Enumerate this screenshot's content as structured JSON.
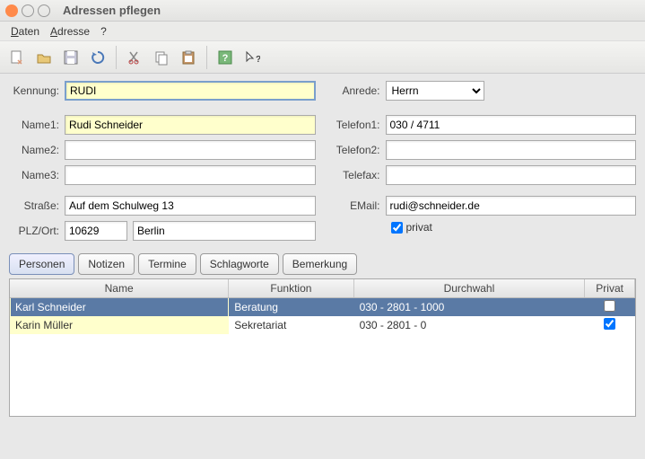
{
  "window": {
    "title": "Adressen pflegen"
  },
  "menu": {
    "daten": "Daten",
    "adresse": "Adresse",
    "help": "?"
  },
  "toolbar_icons": [
    "new",
    "open",
    "save",
    "refresh",
    "cut",
    "copy",
    "paste",
    "help",
    "pointer"
  ],
  "form": {
    "labels": {
      "kennung": "Kennung:",
      "name1": "Name1:",
      "name2": "Name2:",
      "name3": "Name3:",
      "strasse": "Straße:",
      "plzort": "PLZ/Ort:",
      "anrede": "Anrede:",
      "telefon1": "Telefon1:",
      "telefon2": "Telefon2:",
      "telefax": "Telefax:",
      "email": "EMail:",
      "privat": "privat"
    },
    "values": {
      "kennung": "RUDI",
      "name1": "Rudi Schneider",
      "name2": "",
      "name3": "",
      "strasse": "Auf dem Schulweg 13",
      "plz": "10629",
      "ort": "Berlin",
      "anrede": "Herrn",
      "telefon1": "030 / 4711",
      "telefon2": "",
      "telefax": "",
      "email": "rudi@schneider.de",
      "privat": true
    }
  },
  "tabs": {
    "personen": "Personen",
    "notizen": "Notizen",
    "termine": "Termine",
    "schlagworte": "Schlagworte",
    "bemerkung": "Bemerkung"
  },
  "table": {
    "headers": {
      "name": "Name",
      "funktion": "Funktion",
      "durchwahl": "Durchwahl",
      "privat": "Privat"
    },
    "rows": [
      {
        "name": "Karl Schneider",
        "funktion": "Beratung",
        "durchwahl": "030 - 2801 - 1000",
        "privat": false,
        "selected": true
      },
      {
        "name": "Karin Müller",
        "funktion": "Sekretariat",
        "durchwahl": "030 - 2801 - 0",
        "privat": true,
        "selected": false
      }
    ]
  }
}
